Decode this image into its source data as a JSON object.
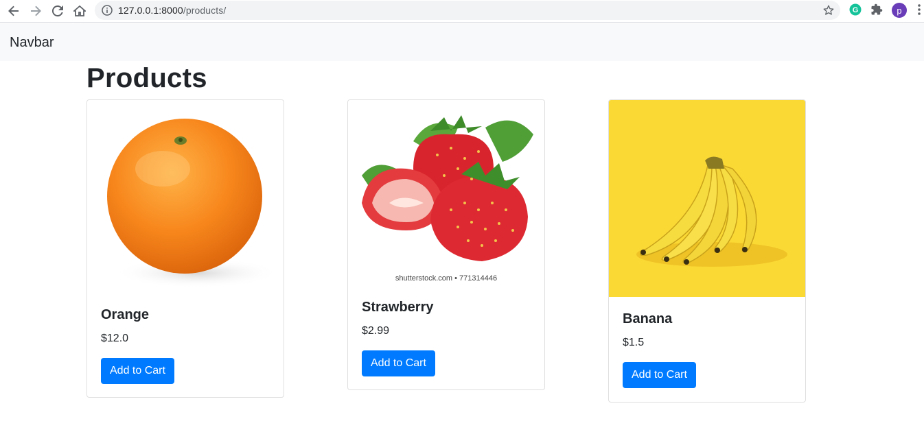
{
  "browser": {
    "url_host": "127.0.0.1:8000",
    "url_path": "/products/",
    "profile_initial": "p"
  },
  "navbar": {
    "brand": "Navbar"
  },
  "page": {
    "title": "Products"
  },
  "products": [
    {
      "name": "Orange",
      "price": "$12.0",
      "button": "Add to Cart"
    },
    {
      "name": "Strawberry",
      "price": "$2.99",
      "button": "Add to Cart",
      "image_caption": "shutterstock.com • 771314446"
    },
    {
      "name": "Banana",
      "price": "$1.5",
      "button": "Add to Cart"
    }
  ],
  "colors": {
    "primary": "#007bff",
    "navbar_bg": "#f8f9fa",
    "banana_bg": "#fbd935"
  }
}
